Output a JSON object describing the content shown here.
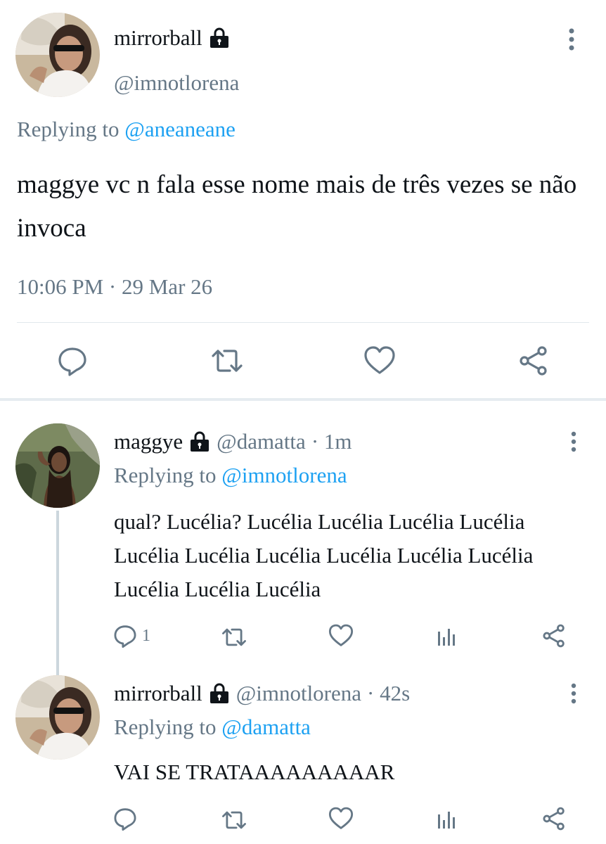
{
  "main_tweet": {
    "display_name": "mirrorball",
    "handle": "@imnotlorena",
    "replying_prefix": "Replying to ",
    "replying_to": "@aneaneane",
    "text": "maggye vc n fala esse nome mais de três vezes se não invoca",
    "timestamp": "10:06 PM · 29 Mar 26"
  },
  "replies": [
    {
      "display_name": "maggye",
      "handle": "@damatta",
      "time": "· 1m",
      "replying_prefix": "Replying to ",
      "replying_to": "@imnotlorena",
      "text": "qual? Lucélia? Lucélia Lucélia Lucélia Lucélia Lucélia Lucélia Lucélia Lucélia Lucélia Lucélia Lucélia Lucélia Lucélia",
      "reply_count": "1"
    },
    {
      "display_name": "mirrorball",
      "handle": "@imnotlorena",
      "time": "· 42s",
      "replying_prefix": "Replying to ",
      "replying_to": "@damatta",
      "text": "VAI SE TRATAAAAAAAAAR",
      "reply_count": ""
    }
  ],
  "icons": [
    "lock-icon",
    "more-icon",
    "reply-icon",
    "retweet-icon",
    "like-icon",
    "share-icon",
    "analytics-icon"
  ],
  "colors": {
    "text": "#0f1419",
    "secondary": "#657786",
    "link": "#1da1f2",
    "divider": "#e1e8ed",
    "thread": "#ccd6dd"
  }
}
